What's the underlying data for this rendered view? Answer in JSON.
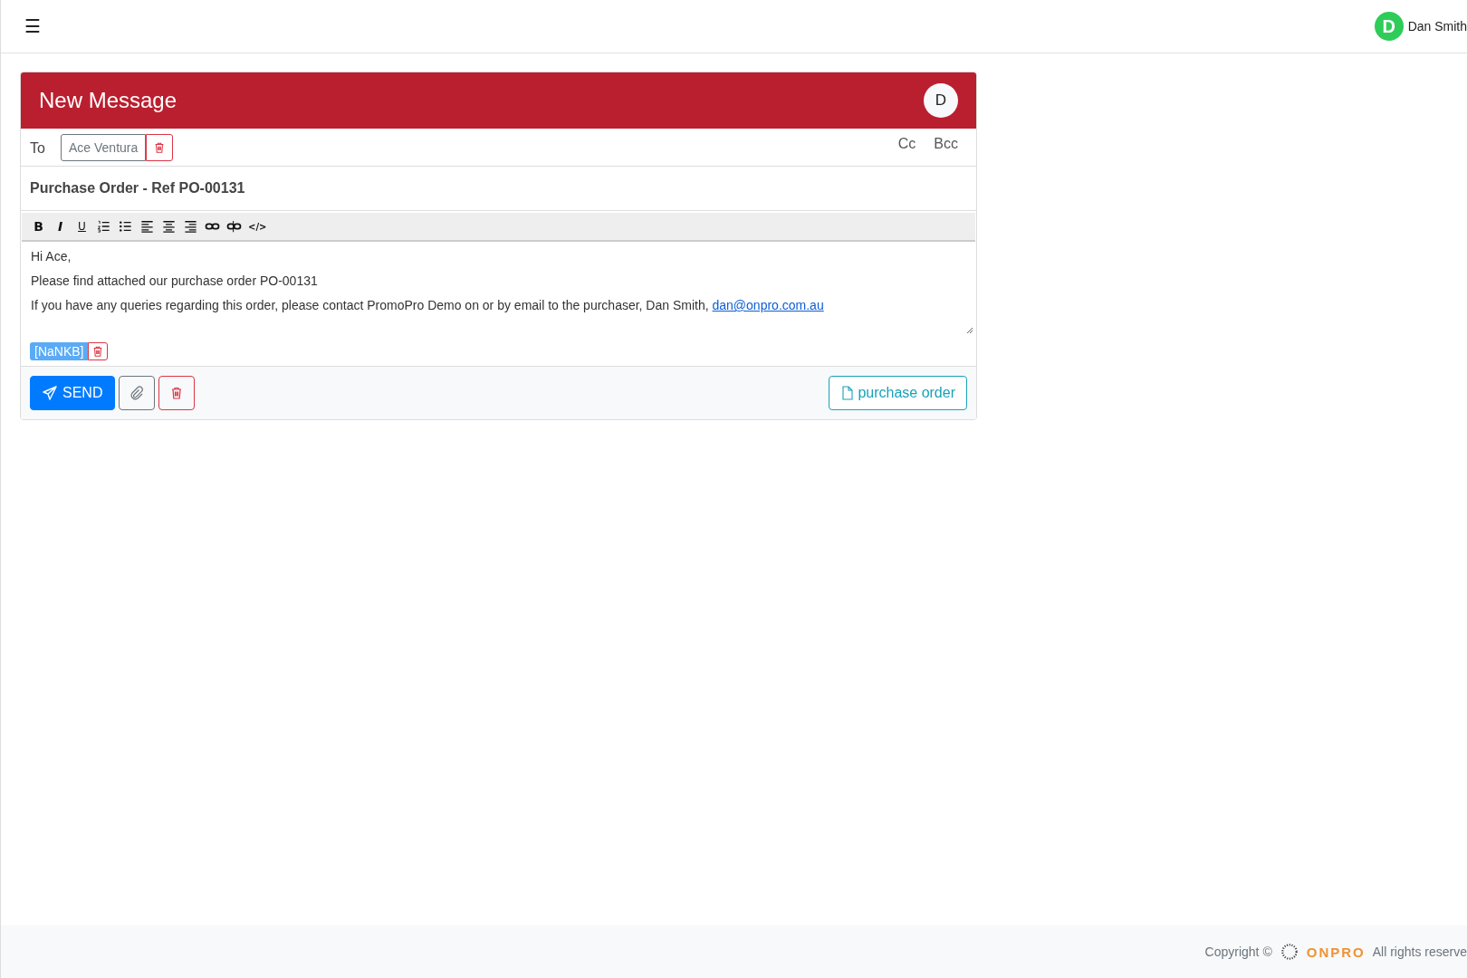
{
  "topbar": {
    "menu_glyph": "☰",
    "user": {
      "initial": "D",
      "name": "Dan Smith"
    }
  },
  "message": {
    "title": "New Message",
    "avatar": "D",
    "to": {
      "label": "To",
      "recipients": [
        {
          "name": "Ace Ventura"
        }
      ],
      "cc": "Cc",
      "bcc": "Bcc"
    },
    "subject": "Purchase Order - Ref PO-00131",
    "toolbar": [
      {
        "kind": "bold",
        "label": "B"
      },
      {
        "kind": "italic",
        "label": "I"
      },
      {
        "kind": "underline",
        "label": "U"
      },
      {
        "kind": "ordered-list"
      },
      {
        "kind": "bullet-list"
      },
      {
        "kind": "align-left"
      },
      {
        "kind": "align-center"
      },
      {
        "kind": "align-right"
      },
      {
        "kind": "link"
      },
      {
        "kind": "unlink"
      },
      {
        "kind": "code",
        "label": "</>"
      }
    ],
    "body": [
      {
        "text": "Hi Ace,"
      },
      {
        "text": "Please find attached our purchase order PO-00131"
      },
      {
        "text": "If you have any queries regarding this order, please contact PromoPro Demo on or by email to the purchaser, Dan Smith,",
        "link": "dan@onpro.com.au"
      }
    ],
    "attachments": [
      {
        "label": "[NaNKB]"
      }
    ],
    "send": "SEND",
    "document_button": "purchase order"
  },
  "footer": {
    "copyright": "Copyright ©",
    "brand": "ONPRO",
    "rights": "All rights reserve"
  }
}
